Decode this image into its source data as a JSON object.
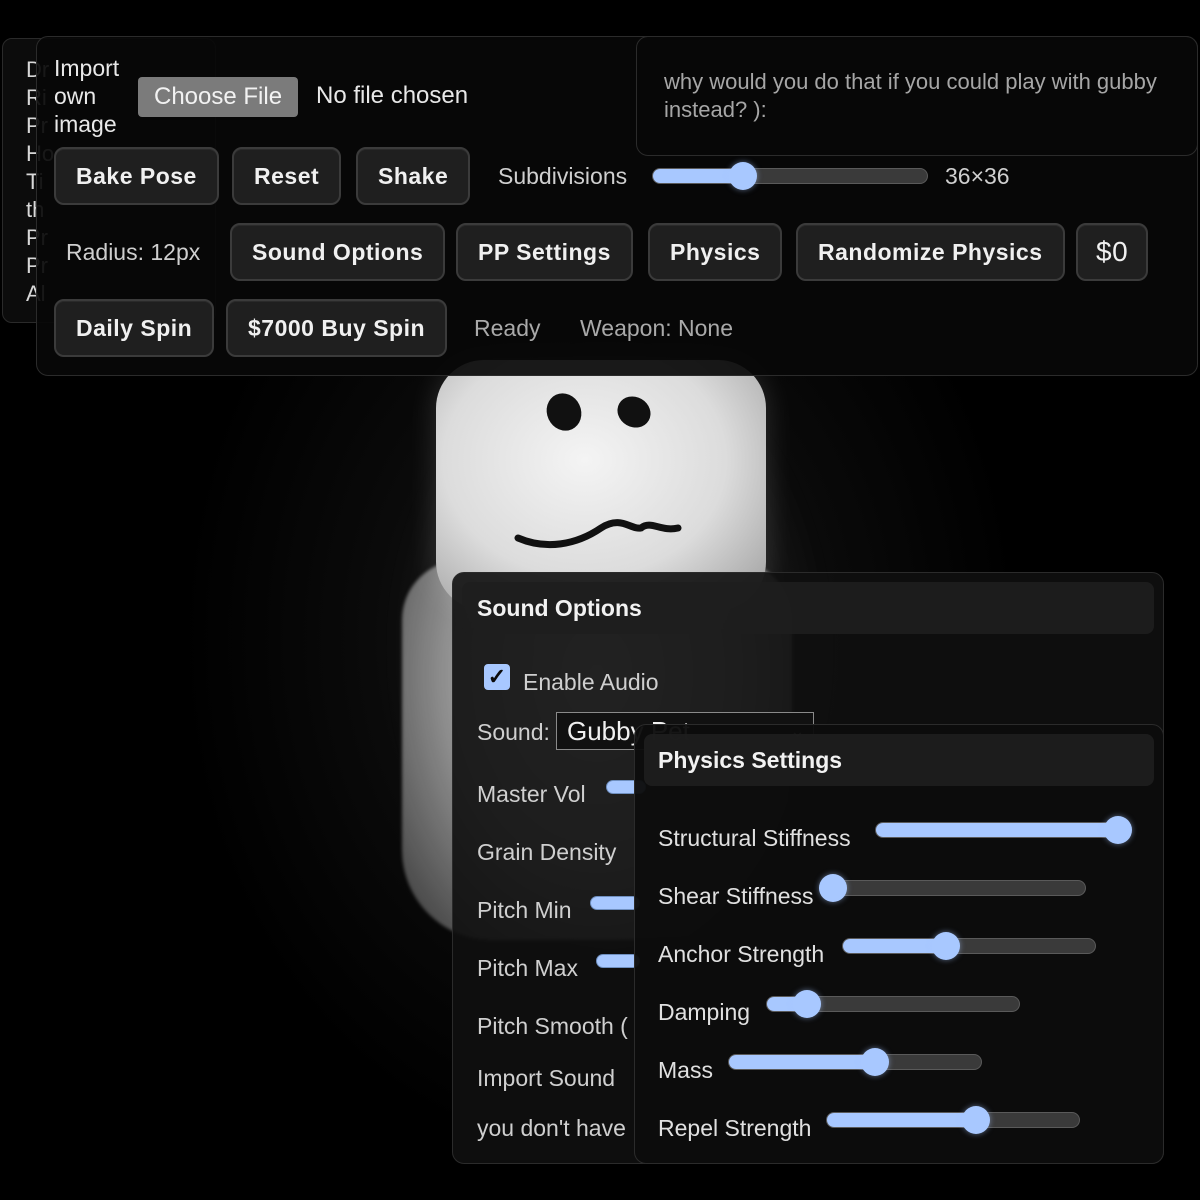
{
  "back_panel": {
    "fragments": [
      "Dr",
      "Ri",
      "Pr",
      "Ho",
      "Ti",
      "th",
      "Pr",
      "Pr",
      "Al"
    ]
  },
  "top": {
    "import_label": "Import own image",
    "choose_file": "Choose File",
    "no_file": "No file chosen",
    "quip": "why would you do that if you could play with gubby instead? ):",
    "buttons": {
      "bake_pose": "Bake Pose",
      "reset": "Reset",
      "shake": "Shake",
      "sound_options": "Sound Options",
      "pp_settings": "PP Settings",
      "physics": "Physics",
      "randomize_physics": "Randomize Physics",
      "money": "$0",
      "daily_spin": "Daily Spin",
      "buy_spin": "$7000 Buy Spin"
    },
    "subdivisions_label": "Subdivisions",
    "subdivisions_value": "36×36",
    "subdivisions_fraction": 0.33,
    "radius": "Radius: 12px",
    "status": "Ready",
    "weapon": "Weapon: None"
  },
  "sound_options": {
    "title": "Sound Options",
    "enable_audio": "Enable Audio",
    "enable_audio_checked": true,
    "sound_label": "Sound:",
    "sound_value": "Gubby Pet",
    "rows": {
      "master_vol": "Master Vol",
      "grain_density": "Grain Density",
      "pitch_min": "Pitch Min",
      "pitch_max": "Pitch Max",
      "pitch_smooth": "Pitch Smooth (",
      "import_sound": "Import Sound",
      "note": "you don't have"
    }
  },
  "physics_settings": {
    "title": "Physics Settings",
    "sliders": [
      {
        "label": "Structural Stiffness",
        "value": 0.96
      },
      {
        "label": "Shear Stiffness",
        "value": 0.0
      },
      {
        "label": "Anchor Strength",
        "value": 0.41
      },
      {
        "label": "Damping",
        "value": 0.16
      },
      {
        "label": "Mass",
        "value": 0.58
      },
      {
        "label": "Repel Strength",
        "value": 0.59
      }
    ]
  },
  "colors": {
    "accent": "#a8c8ff",
    "panel": "#101010",
    "button": "#1f1f1f"
  }
}
